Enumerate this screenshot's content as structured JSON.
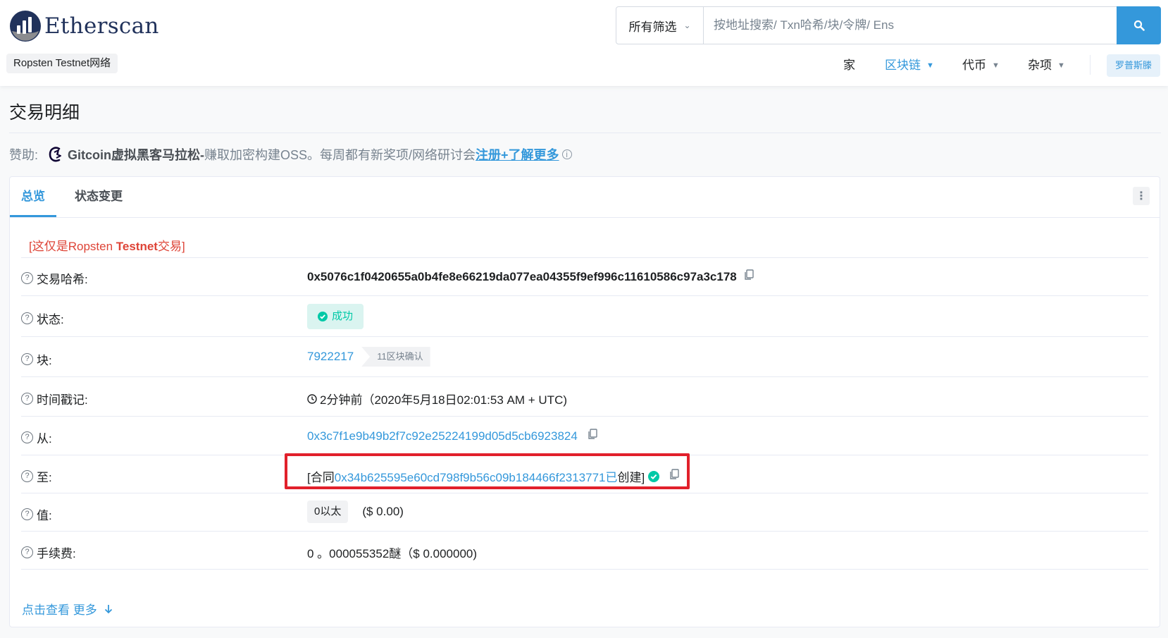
{
  "header": {
    "logo_text": "Etherscan",
    "network": "Ropsten Testnet网络",
    "search": {
      "filter_label": "所有筛选",
      "placeholder": "按地址搜索/ Txn哈希/块/令牌/ Ens"
    },
    "nav": {
      "home": "家",
      "blockchain": "区块链",
      "tokens": "代币",
      "misc": "杂项",
      "network_button": "罗普斯滕"
    }
  },
  "page": {
    "title": "交易明细",
    "sponsor": {
      "label": "赞助:",
      "name": "Gitcoin虚拟黑客马拉松-",
      "text": "赚取加密构建OSS。每周都有新奖项/网络研讨会",
      "link": "注册+了解更多"
    }
  },
  "tabs": {
    "overview": "总览",
    "state": "状态变更"
  },
  "notice": {
    "open": "[这仅是Ropsten ",
    "bold": "Testnet",
    "close": "交易]"
  },
  "details": {
    "hash": {
      "label": "交易哈希:",
      "value": "0x5076c1f0420655a0b4fe8e66219da077ea04355f9ef996c11610586c97a3c178"
    },
    "status": {
      "label": "状态:",
      "value": "成功"
    },
    "block": {
      "label": "块:",
      "number": "7922217",
      "confirmations": "11区块确认"
    },
    "timestamp": {
      "label": "时间戳记:",
      "value": "2分钟前（2020年5月18日02:01:53 AM + UTC)"
    },
    "from": {
      "label": "从:",
      "value": "0x3c7f1e9b49b2f7c92e25224199d05d5cb6923824"
    },
    "to": {
      "label": "至:",
      "prefix": "[合同",
      "address": "0x34b625595e60cd798f9b56c09b184466f2313771已",
      "suffix": " 创建]"
    },
    "value": {
      "label": "值:",
      "amount": "0以太",
      "usd": "($ 0.00)"
    },
    "fee": {
      "label": "手续费:",
      "value": "0 。000055352醚（$ 0.000000)"
    }
  },
  "more_link": "点击查看 更多",
  "colors": {
    "primary": "#3498db",
    "success": "#00c9a7",
    "danger": "#de4437",
    "highlight": "#e1202b"
  }
}
